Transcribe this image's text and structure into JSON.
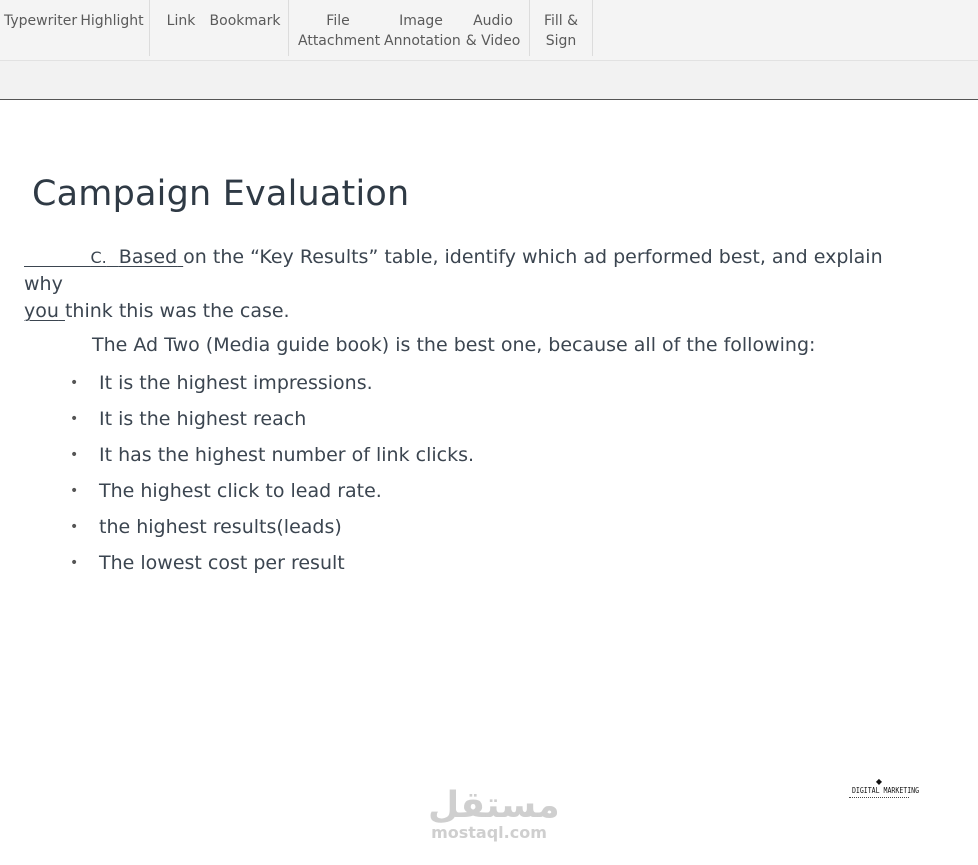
{
  "toolbar": {
    "items": [
      {
        "line1": "Typewriter",
        "line2": ""
      },
      {
        "line1": "Highlight",
        "line2": ""
      },
      {
        "line1": "Link",
        "line2": ""
      },
      {
        "line1": "Bookmark",
        "line2": ""
      },
      {
        "line1": "File",
        "line2": "Attachment"
      },
      {
        "line1": "Image",
        "line2": "Annotation"
      },
      {
        "line1": "Audio",
        "line2": "& Video"
      },
      {
        "line1": "Fill &",
        "line2": "Sign"
      }
    ],
    "highlight_color": "#f5a623"
  },
  "document": {
    "title": "Campaign Evaluation",
    "question": {
      "letter": "C.",
      "word_based": "Based",
      "text_line1": "on the “Key Results” table, identify which ad performed best, and explain why",
      "word_you": "you",
      "text_line2": "think this was the case."
    },
    "answer_intro": "The Ad Two (Media guide book) is the best one, because all of the following:",
    "bullets": [
      "It is the highest impressions.",
      "It is the highest reach",
      "It has the highest number of link clicks.",
      "The highest click to lead rate.",
      "the highest results(leads)",
      "The lowest cost per result"
    ],
    "bullet_glyph": "•"
  },
  "logo": {
    "text": "DIGITAL MARKETING",
    "glyph": "◆"
  },
  "watermark": {
    "arabic": "مستقل",
    "latin": "mostaql.com"
  }
}
